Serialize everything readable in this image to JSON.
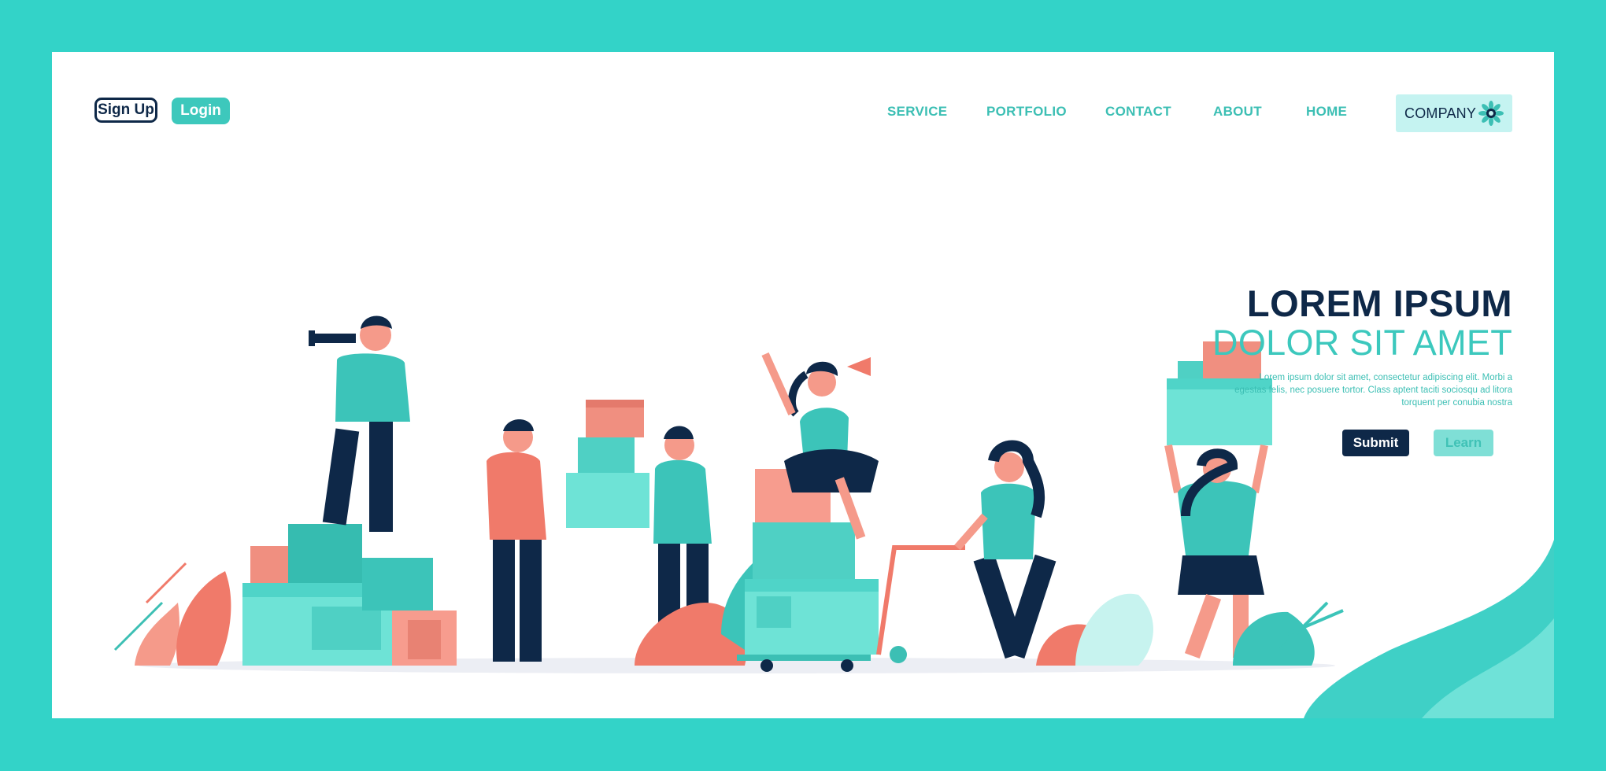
{
  "header": {
    "signup_label": "Sign Up",
    "login_label": "Login",
    "nav": [
      "SERVICE",
      "PORTFOLIO",
      "CONTACT",
      "ABOUT",
      "HOME"
    ],
    "company_label": "COMPANY",
    "company_icon": "gear-flower-icon"
  },
  "hero": {
    "title": "LOREM IPSUM",
    "subtitle": "DOLOR SIT AMET",
    "body": "Lorem ipsum dolor sit amet, consectetur adipiscing elit. Morbi a egestas felis, nec posuere tortor. Class aptent taciti sociosqu ad litora torquent per conubia nostra",
    "submit_label": "Submit",
    "learn_label": "Learn"
  },
  "colors": {
    "background": "#33d3c8",
    "navy": "#0e2848",
    "teal": "#3cc8bd",
    "mint": "#6ee3d6",
    "coral": "#f07a6a"
  }
}
